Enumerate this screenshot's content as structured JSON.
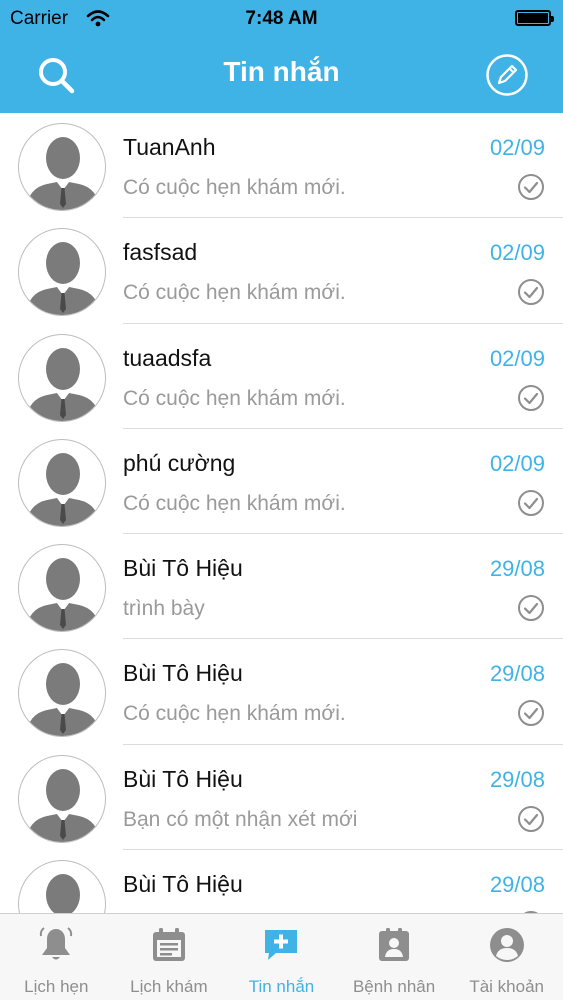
{
  "status_bar": {
    "carrier": "Carrier",
    "time": "7:48 AM"
  },
  "nav": {
    "title": "Tin nhắn",
    "left_icon": "search-icon",
    "right_icon": "compose-icon"
  },
  "messages": [
    {
      "name": "TuanAnh",
      "date": "02/09",
      "preview": "Có cuộc hẹn khám mới."
    },
    {
      "name": "fasfsad",
      "date": "02/09",
      "preview": "Có cuộc hẹn khám mới."
    },
    {
      "name": "tuaadsfa",
      "date": "02/09",
      "preview": "Có cuộc hẹn khám mới."
    },
    {
      "name": "phú cường",
      "date": "02/09",
      "preview": "Có cuộc hẹn khám mới."
    },
    {
      "name": "Bùi Tô Hiệu",
      "date": "29/08",
      "preview": "trình bày"
    },
    {
      "name": "Bùi Tô Hiệu",
      "date": "29/08",
      "preview": "Có cuộc hẹn khám mới."
    },
    {
      "name": "Bùi Tô Hiệu",
      "date": "29/08",
      "preview": "Bạn có một nhận xét mới"
    },
    {
      "name": "Bùi Tô Hiệu",
      "date": "29/08",
      "preview": ""
    }
  ],
  "tabs": [
    {
      "label": "Lịch hẹn",
      "icon": "bell-icon",
      "active": false
    },
    {
      "label": "Lịch khám",
      "icon": "calendar-icon",
      "active": false
    },
    {
      "label": "Tin nhắn",
      "icon": "message-plus-icon",
      "active": true
    },
    {
      "label": "Bệnh nhân",
      "icon": "patient-card-icon",
      "active": false
    },
    {
      "label": "Tài khoản",
      "icon": "account-icon",
      "active": false
    }
  ],
  "colors": {
    "accent": "#40b3e6",
    "tab_inactive": "#8e8e8e",
    "preview_text": "#9a9a9a",
    "avatar": "#7b7b7b"
  }
}
